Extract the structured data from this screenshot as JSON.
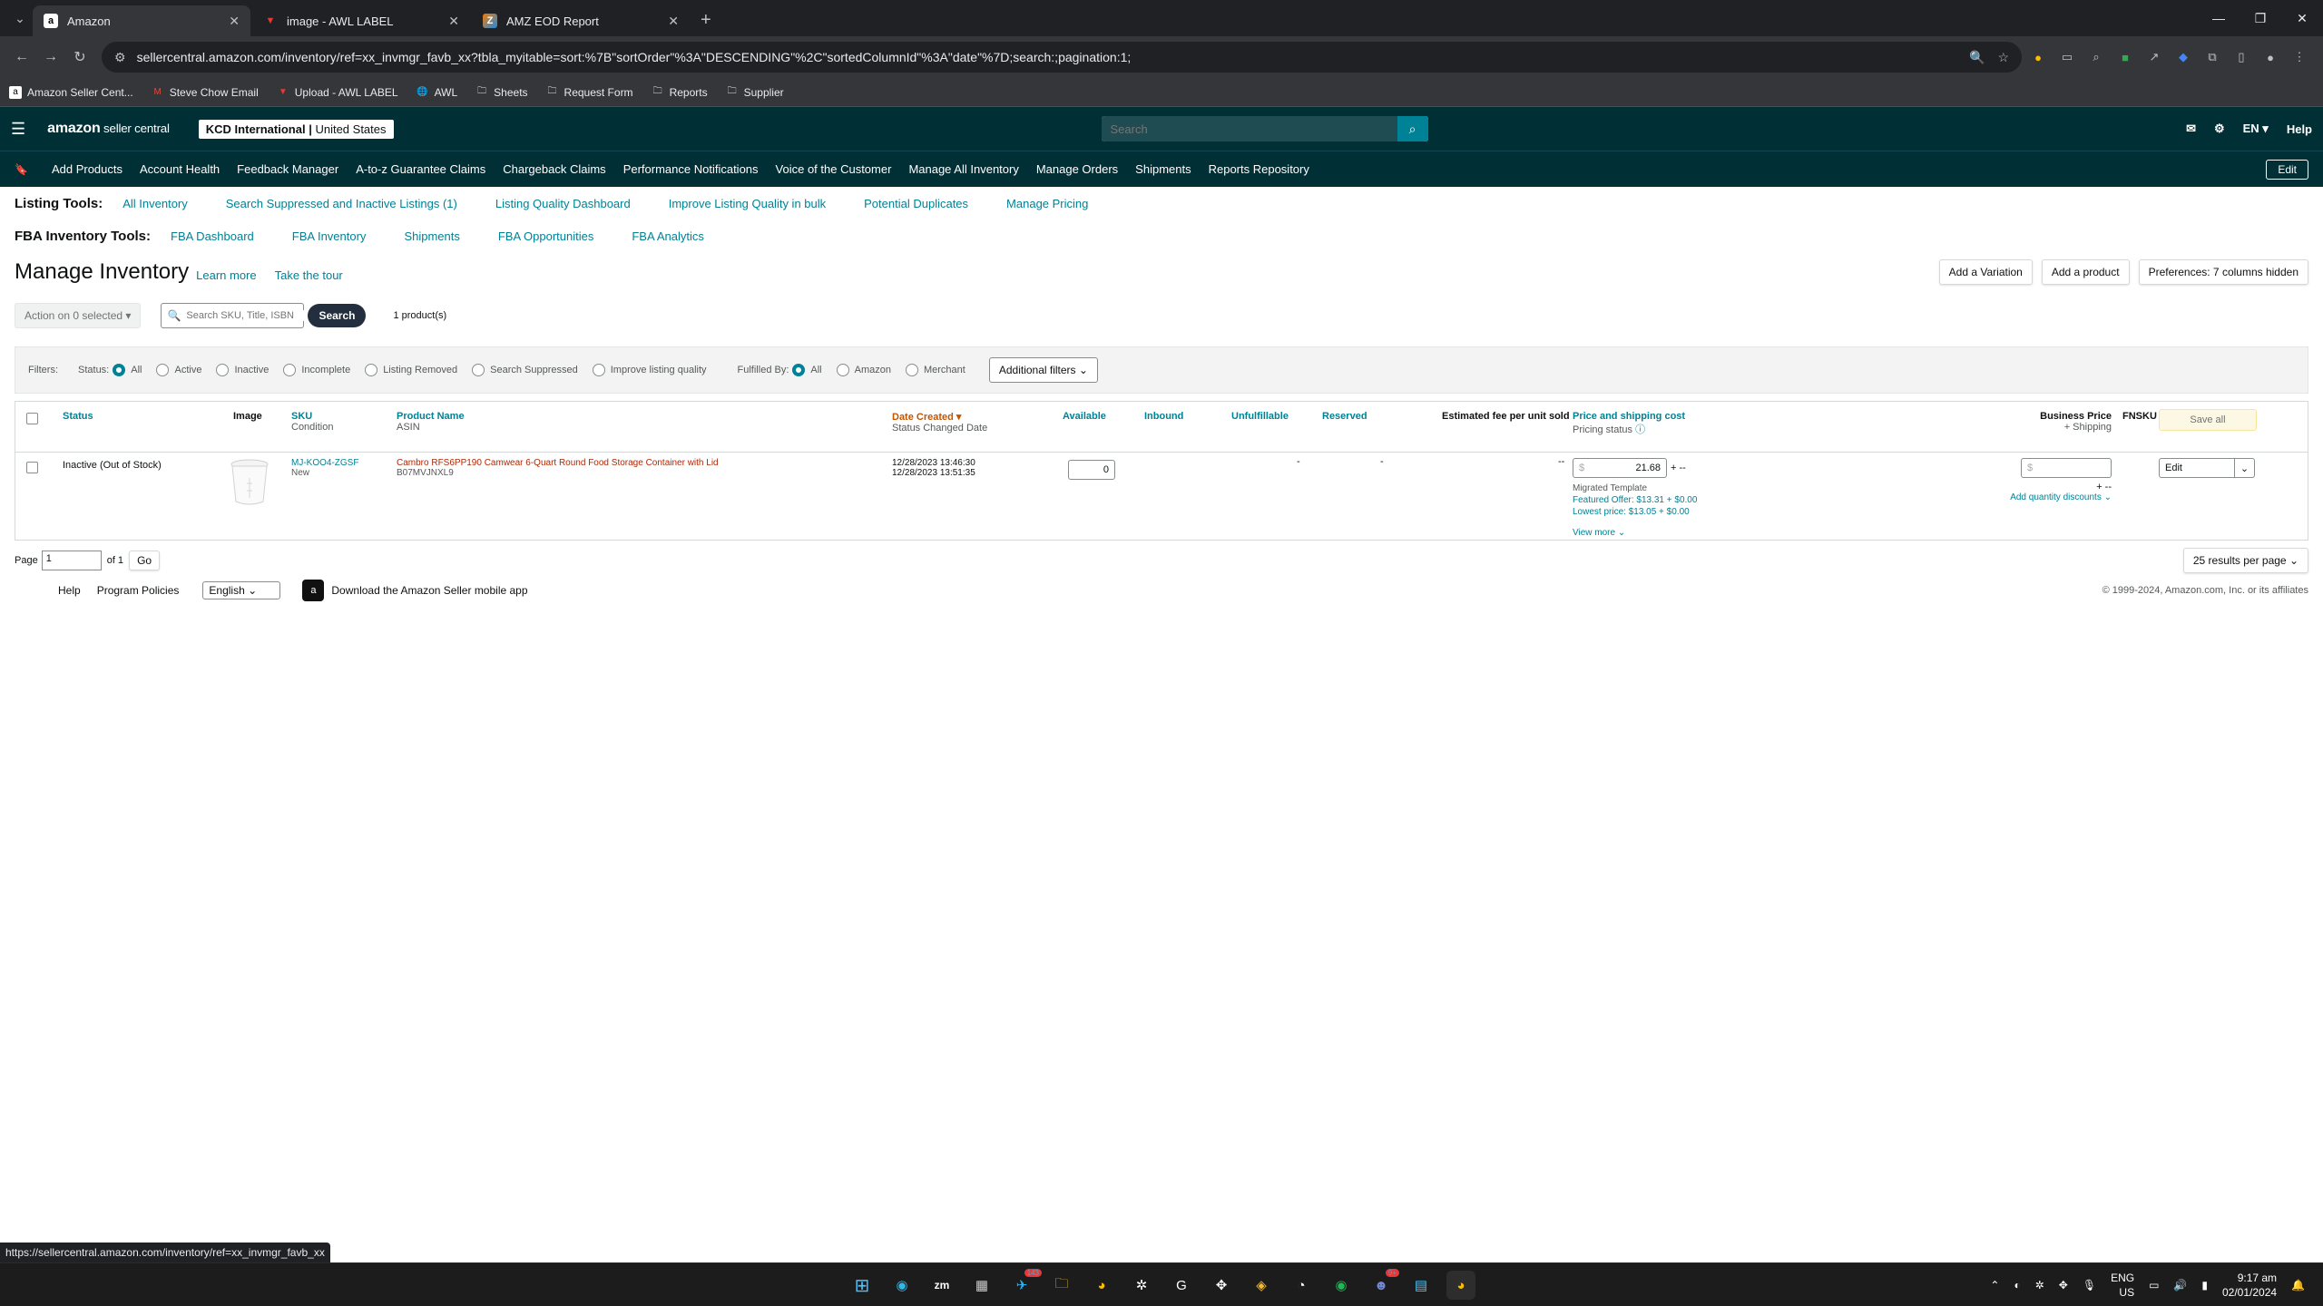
{
  "browser": {
    "tabs": [
      {
        "title": "Amazon",
        "favicon": "a"
      },
      {
        "title": "image - AWL LABEL",
        "favicon": "▼"
      },
      {
        "title": "AMZ EOD Report",
        "favicon": "Z"
      }
    ],
    "url": "sellercentral.amazon.com/inventory/ref=xx_invmgr_favb_xx?tbla_myitable=sort:%7B\"sortOrder\"%3A\"DESCENDING\"%2C\"sortedColumnId\"%3A\"date\"%7D;search:;pagination:1;",
    "bookmarks": [
      "Amazon Seller Cent...",
      "Steve Chow Email",
      "Upload - AWL LABEL",
      "AWL",
      "Sheets",
      "Request Form",
      "Reports",
      "Supplier"
    ],
    "status_url": "https://sellercentral.amazon.com/inventory/ref=xx_invmgr_favb_xx"
  },
  "header": {
    "logo_main": "amazon",
    "logo_sub": " seller central",
    "account_name": "KCD International",
    "account_region": "United States",
    "search_placeholder": "Search",
    "lang": "EN",
    "help": "Help"
  },
  "nav": {
    "items": [
      "Add Products",
      "Account Health",
      "Feedback Manager",
      "A-to-z Guarantee Claims",
      "Chargeback Claims",
      "Performance Notifications",
      "Voice of the Customer",
      "Manage All Inventory",
      "Manage Orders",
      "Shipments",
      "Reports Repository"
    ],
    "edit": "Edit"
  },
  "listing_tools": {
    "label": "Listing Tools:",
    "links": [
      "All Inventory",
      "Search Suppressed and Inactive Listings (1)",
      "Listing Quality Dashboard",
      "Improve Listing Quality in bulk",
      "Potential Duplicates",
      "Manage Pricing"
    ]
  },
  "fba_tools": {
    "label": "FBA Inventory Tools:",
    "links": [
      "FBA Dashboard",
      "FBA Inventory",
      "Shipments",
      "FBA Opportunities",
      "FBA Analytics"
    ]
  },
  "page": {
    "title": "Manage Inventory",
    "learn_more": "Learn more",
    "take_tour": "Take the tour",
    "add_variation": "Add a Variation",
    "add_product": "Add a product",
    "preferences": "Preferences: 7 columns hidden",
    "action_select": "Action on 0 selected",
    "search_placeholder": "Search SKU, Title, ISBN",
    "search_btn": "Search",
    "product_count": "1 product(s)"
  },
  "filters": {
    "label": "Filters:",
    "status_label": "Status:",
    "status_options": [
      "All",
      "Active",
      "Inactive",
      "Incomplete",
      "Listing Removed",
      "Search Suppressed",
      "Improve listing quality"
    ],
    "fulfilled_label": "Fulfilled By:",
    "fulfilled_options": [
      "All",
      "Amazon",
      "Merchant"
    ],
    "additional": "Additional filters"
  },
  "table": {
    "headers": {
      "status": "Status",
      "image": "Image",
      "sku": "SKU",
      "condition": "Condition",
      "product_name": "Product Name",
      "asin": "ASIN",
      "date_created": "Date Created",
      "status_changed": "Status Changed Date",
      "available": "Available",
      "inbound": "Inbound",
      "unfulfillable": "Unfulfillable",
      "reserved": "Reserved",
      "est_fee": "Estimated fee per unit sold",
      "price": "Price and shipping cost",
      "pricing_status": "Pricing status",
      "business_price": "Business Price",
      "plus_shipping": "+ Shipping",
      "fnsku": "FNSKU",
      "save_all": "Save all"
    },
    "rows": [
      {
        "status": "Inactive (Out of Stock)",
        "sku": "MJ-KOO4-ZGSF",
        "condition": "New",
        "product_name": "Cambro RFS6PP190 Camwear 6-Quart Round Food Storage Container with Lid",
        "asin": "B07MVJNXL9",
        "date_created": "12/28/2023 13:46:30",
        "status_changed": "12/28/2023 13:51:35",
        "available": "0",
        "unfulfillable": "-",
        "reserved": "-",
        "est_fee": "--",
        "price_currency": "$",
        "price": "21.68",
        "price_suffix": "+ --",
        "pricing_template": "Migrated Template",
        "featured_offer": "Featured Offer: $13.31 + $0.00",
        "lowest_price": "Lowest price: $13.05 + $0.00",
        "view_more": "View more",
        "business_currency": "$",
        "business_suffix": "+ --",
        "quantity_discounts": "Add quantity discounts",
        "edit": "Edit"
      }
    ]
  },
  "pager": {
    "page_label": "Page",
    "page": "1",
    "of": "of 1",
    "go": "Go",
    "per_page": "25 results per page"
  },
  "footer": {
    "help": "Help",
    "policies": "Program Policies",
    "language": "English",
    "app": "Download the Amazon Seller mobile app",
    "copyright": "© 1999-2024, Amazon.com, Inc. or its affiliates"
  },
  "taskbar": {
    "lang": "ENG",
    "region": "US",
    "time": "9:17 am",
    "date": "02/01/2024",
    "mail_badge": "143",
    "discord_badge": "9+"
  }
}
